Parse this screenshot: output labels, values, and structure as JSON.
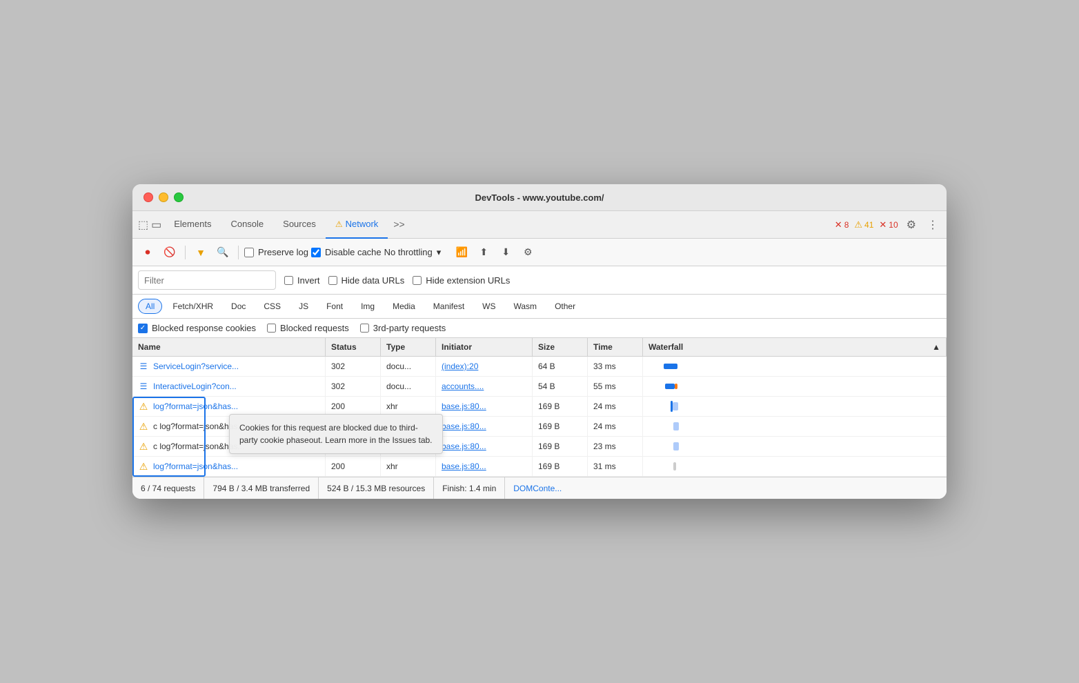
{
  "window": {
    "title": "DevTools - www.youtube.com/"
  },
  "tabs": {
    "items": [
      {
        "label": "Elements",
        "active": false
      },
      {
        "label": "Console",
        "active": false
      },
      {
        "label": "Sources",
        "active": false
      },
      {
        "label": "Network",
        "active": true,
        "warning": true
      },
      {
        "label": ">>",
        "active": false
      }
    ],
    "errors": "8",
    "warnings": "41",
    "info": "10"
  },
  "toolbar": {
    "preserve_log_label": "Preserve log",
    "disable_cache_label": "Disable cache",
    "throttle_label": "No throttling"
  },
  "filter": {
    "placeholder": "Filter",
    "invert_label": "Invert",
    "hide_data_label": "Hide data URLs",
    "hide_ext_label": "Hide extension URLs"
  },
  "type_filters": [
    "All",
    "Fetch/XHR",
    "Doc",
    "CSS",
    "JS",
    "Font",
    "Img",
    "Media",
    "Manifest",
    "WS",
    "Wasm",
    "Other"
  ],
  "blocked_bar": {
    "blocked_cookies": "Blocked response cookies",
    "blocked_requests": "Blocked requests",
    "third_party": "3rd-party requests"
  },
  "table": {
    "headers": [
      "Name",
      "Status",
      "Type",
      "Initiator",
      "Size",
      "Time",
      "Waterfall"
    ],
    "rows": [
      {
        "icon": "doc",
        "name": "ServiceLogin?service...",
        "status": "302",
        "type": "docu...",
        "initiator": "(index):20",
        "size": "64 B",
        "time": "33 ms",
        "warning": false
      },
      {
        "icon": "doc",
        "name": "InteractiveLogin?con...",
        "status": "302",
        "type": "docu...",
        "initiator": "accounts....",
        "size": "54 B",
        "time": "55 ms",
        "warning": false
      },
      {
        "icon": "warning",
        "name": "log?format=json&has...",
        "status": "200",
        "type": "xhr",
        "initiator": "base.js:80...",
        "size": "169 B",
        "time": "24 ms",
        "warning": true
      },
      {
        "icon": "warning",
        "name": "c log?format=json&has...",
        "status": "",
        "type": "",
        "initiator": "base.js:80...",
        "size": "169 B",
        "time": "24 ms",
        "warning": true
      },
      {
        "icon": "warning",
        "name": "c log?format=json&has...",
        "status": "",
        "type": "",
        "initiator": "base.js:80...",
        "size": "169 B",
        "time": "23 ms",
        "warning": true
      },
      {
        "icon": "warning",
        "name": "log?format=json&has...",
        "status": "200",
        "type": "xhr",
        "initiator": "base.js:80...",
        "size": "169 B",
        "time": "31 ms",
        "warning": true
      }
    ]
  },
  "tooltip": {
    "text": "Cookies for this request are blocked due to third-party cookie phaseout. Learn more in the Issues tab."
  },
  "status_bar": {
    "requests": "6 / 74 requests",
    "transferred": "794 B / 3.4 MB transferred",
    "resources": "524 B / 15.3 MB resources",
    "finish": "Finish: 1.4 min",
    "domcontent": "DOMConte..."
  }
}
